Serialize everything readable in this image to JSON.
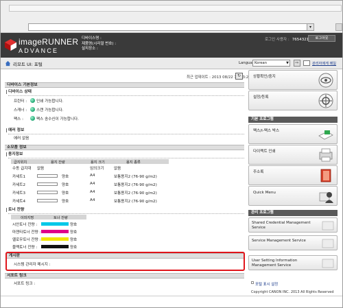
{
  "header": {
    "brand_line1": "imageRUNNER",
    "brand_line2": "ADVANCE",
    "device_name_label": "디바이스명 :",
    "product_name_label": "제품명(시리얼 번호) :",
    "location_label": "설치장소 :",
    "login_user_label": "로그인 사용자 :",
    "login_user_value": "7654321",
    "logout_label": "로그아웃"
  },
  "titlebar": {
    "page_title": "리모트 UI: 포털",
    "language_label": "Language:",
    "language_value": "Korean",
    "admin_link": "관리자에게 메일"
  },
  "main": {
    "last_updated": "최근 업데이트 : 2013 08/22 16:03:24",
    "device_basic_info": "디바이스 기본정보",
    "device_status": "디바이스 상태",
    "status_rows": [
      {
        "label": "프린터 :",
        "value": "인쇄 가능합니다."
      },
      {
        "label": "스캐너 :",
        "value": "스캔 가능합니다."
      },
      {
        "label": "팩스 :",
        "value": "팩스 송수신이 가능합니다."
      }
    ],
    "error_info": "에러 정보",
    "error_value": "에러 없음",
    "consumables_info": "소모품 정보",
    "paper_info": "용지정보",
    "paper_headers": [
      "급지위치",
      "용지 잔량",
      "용지 크기",
      "용지 종류"
    ],
    "paper_rows": [
      {
        "source": "수동 급지대",
        "level": "없음",
        "size": "임의크기",
        "type": "없음"
      },
      {
        "source": "카세트1",
        "level": "양호",
        "size": "A4",
        "type": "보통용지2 (76-90 g/m2)"
      },
      {
        "source": "카세트2",
        "level": "양호",
        "size": "A4",
        "type": "보통용지2 (76-90 g/m2)"
      },
      {
        "source": "카세트3",
        "level": "양호",
        "size": "A4",
        "type": "보통용지2 (76-90 g/m2)"
      },
      {
        "source": "카세트4",
        "level": "양호",
        "size": "A4",
        "type": "보통용지2 (76-90 g/m2)"
      }
    ],
    "toner_info": "토너 잔량",
    "toner_headers": [
      "이미지명",
      "토너 잔량"
    ],
    "toner_rows": [
      {
        "name": "시안토너 잔량 :",
        "level": "양호",
        "color": "#00c8e8"
      },
      {
        "name": "마젠타토너 잔량 :",
        "level": "양호",
        "color": "#e0008a"
      },
      {
        "name": "옐로우토너 잔량 :",
        "level": "양호",
        "color": "#f2e600"
      },
      {
        "name": "블랙토너 잔량 :",
        "level": "양호",
        "color": "#111111"
      }
    ],
    "bulletin_title": "게시판",
    "bulletin_text": "시스템 관리자 메시지 :",
    "support_title": "서포트 링크",
    "support_text": "서포트 링크 :",
    "copyright": "Copyright CANON INC. 2013 All Rights Reserved"
  },
  "sidebar": {
    "buttons_top": [
      {
        "label": "상황확인/중지",
        "icon": "status-icon"
      },
      {
        "label": "설정/등록",
        "icon": "settings-icon"
      }
    ],
    "basic_title": "기본 프로그램",
    "basic_buttons": [
      {
        "label": "팩스/I-팩스 박스",
        "icon": "fax-box-icon"
      },
      {
        "label": "다이렉트 인쇄",
        "icon": "direct-print-icon"
      },
      {
        "label": "주소록",
        "icon": "address-book-icon"
      },
      {
        "label": "Quick Menu",
        "icon": "quick-menu-icon"
      }
    ],
    "admin_title": "관리 프로그램",
    "admin_buttons": [
      {
        "label": "Shared Credential Management Service"
      },
      {
        "label": "Service Management Service"
      },
      {
        "label": "User Setting Information Management Service"
      }
    ],
    "remote_link": "포털 표시 설정"
  },
  "colors": {
    "highlight": "#e0141a",
    "header_bg": "#3a3a3a",
    "section_bg": "#dedede"
  }
}
